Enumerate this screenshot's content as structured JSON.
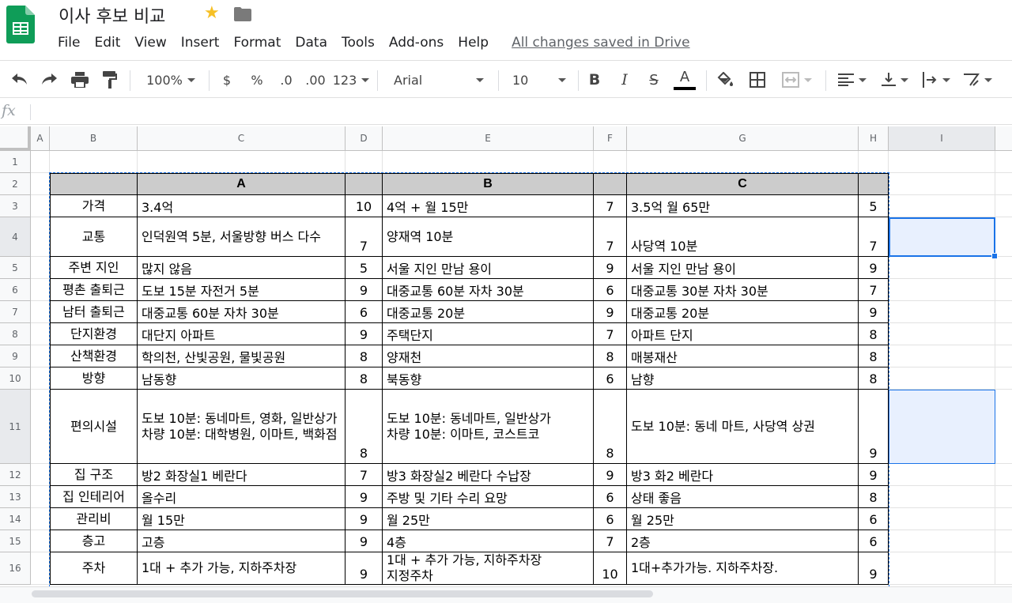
{
  "app": {
    "doc_title": "이사 후보 비교",
    "saved_status": "All changes saved in Drive",
    "icons": {
      "logo": "sheets-logo-icon",
      "star": "star-icon",
      "folder": "folder-icon"
    },
    "accent_color": "#1a73e8"
  },
  "menu": [
    "File",
    "Edit",
    "View",
    "Insert",
    "Format",
    "Data",
    "Tools",
    "Add-ons",
    "Help"
  ],
  "toolbar": {
    "zoom": "100%",
    "currency": "$",
    "percent": "%",
    "dec_less": ".0",
    "dec_more": ".00",
    "more_formats": "123",
    "font": "Arial",
    "font_size": "10",
    "bold": "B",
    "italic": "I",
    "strike": "S",
    "text_color": "A"
  },
  "formula_bar": {
    "fx_label": "fx",
    "value": ""
  },
  "columns": [
    "A",
    "B",
    "C",
    "D",
    "E",
    "F",
    "G",
    "H",
    "I"
  ],
  "rows": [
    "1",
    "2",
    "3",
    "4",
    "5",
    "6",
    "7",
    "8",
    "9",
    "10",
    "11",
    "12",
    "13",
    "14",
    "15",
    "16"
  ],
  "table": {
    "headers": [
      "",
      "A",
      "",
      "B",
      "",
      "C",
      ""
    ],
    "rows": [
      [
        "가격",
        "3.4억",
        "10",
        "4억 + 월 15만",
        "7",
        "3.5억 월 65만",
        "5"
      ],
      [
        "교통",
        "인덕원역 5분, 서울방향 버스 다수",
        "7",
        "양재역 10분",
        "7",
        "사당역 10분",
        "7"
      ],
      [
        "주변 지인",
        "많지 않음",
        "5",
        "서울 지인 만남 용이",
        "9",
        "서울 지인 만남 용이",
        "9"
      ],
      [
        "평촌 출퇴근",
        "도보 15분 자전거 5분",
        "9",
        "대중교통 60분 자차 30분",
        "6",
        "대중교통 30분 자차 30분",
        "7"
      ],
      [
        "남터 출퇴근",
        "대중교통 60분 자차 30분",
        "6",
        "대중교통 20분",
        "9",
        "대중교통 20분",
        "9"
      ],
      [
        "단지환경",
        "대단지 아파트",
        "9",
        "주택단지",
        "7",
        "아파트 단지",
        "8"
      ],
      [
        "산책환경",
        "학의천, 산빛공원, 물빛공원",
        "8",
        "양재천",
        "8",
        "매봉재산",
        "8"
      ],
      [
        "방향",
        "남동향",
        "8",
        "북동향",
        "6",
        "남향",
        "8"
      ],
      [
        "편의시설",
        "도보 10분: 동네마트, 영화, 일반상가\n차량 10분: 대학병원, 이마트, 백화점",
        "8",
        "도보 10분: 동네마트, 일반상가\n차량 10분: 이마트, 코스트코",
        "8",
        "도보 10분: 동네 마트, 사당역 상권",
        "9"
      ],
      [
        "집 구조",
        "방2 화장실1 베란다",
        "7",
        "방3 화장실2 베란다 수납장",
        "9",
        "방3 화2 베란다",
        "9"
      ],
      [
        "집 인테리어",
        "올수리",
        "9",
        "주방 및 기타 수리 요망",
        "6",
        "상태 좋음",
        "8"
      ],
      [
        "관리비",
        "월 15만",
        "9",
        "월 25만",
        "6",
        "월 25만",
        "6"
      ],
      [
        "층고",
        "고층",
        "9",
        "4층",
        "7",
        "2층",
        "6"
      ],
      [
        "주차",
        "1대 + 추가 가능, 지하주차장",
        "9",
        "1대 + 추가 가능, 지하주차장\n지정주차",
        "10",
        "1대+추가가능. 지하주차장.",
        "9"
      ]
    ]
  }
}
